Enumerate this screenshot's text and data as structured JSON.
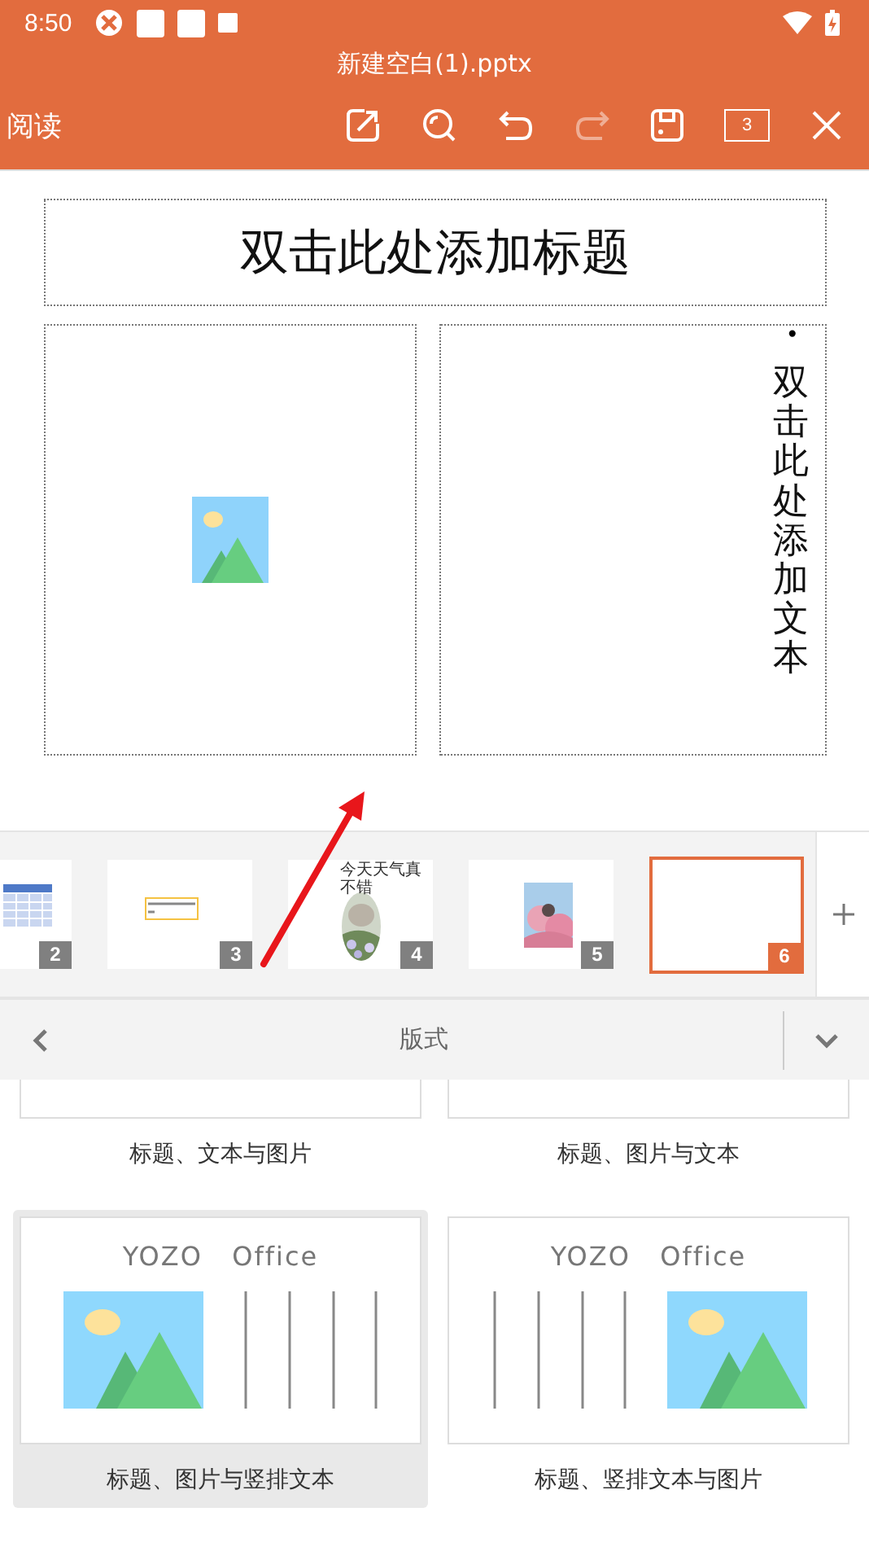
{
  "status_bar": {
    "time": "8:50"
  },
  "title": "新建空白(1).pptx",
  "toolbar": {
    "mode": "阅读",
    "page_count": "3",
    "tools": [
      {
        "kind": "edit",
        "disabled": false
      },
      {
        "kind": "search",
        "disabled": false
      },
      {
        "kind": "undo",
        "disabled": false
      },
      {
        "kind": "redo",
        "disabled": true
      },
      {
        "kind": "save",
        "disabled": false
      }
    ]
  },
  "slide": {
    "title_placeholder": "双击此处添加标题",
    "text_placeholder": "双击此处添加文本",
    "bullet": "•"
  },
  "thumbnails": [
    {
      "number": "2",
      "kind": "table",
      "selected": false
    },
    {
      "number": "3",
      "kind": "textbox",
      "selected": false
    },
    {
      "number": "4",
      "kind": "oval_photo",
      "selected": false,
      "caption": [
        "今天天气真",
        "不错"
      ]
    },
    {
      "number": "5",
      "selected": false
    },
    {
      "number": "6",
      "kind": "blank",
      "selected": true
    }
  ],
  "panel": {
    "title": "版式"
  },
  "layouts": [
    {
      "name": "标题、文本与图片",
      "kind": "cut",
      "selected": false
    },
    {
      "name": "标题、图片与文本",
      "kind": "cut",
      "selected": false
    },
    {
      "name": "标题、图片与竖排文本",
      "kind": "picture_vertical",
      "selected": true,
      "heading": "YOZO   Office"
    },
    {
      "name": "标题、竖排文本与图片",
      "kind": "vertical_picture",
      "selected": false,
      "heading": "YOZO   Office"
    }
  ]
}
